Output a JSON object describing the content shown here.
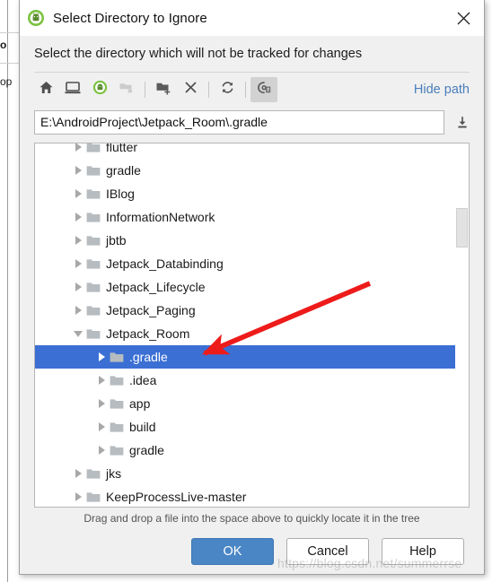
{
  "window": {
    "title": "Select Directory to Ignore",
    "app_icon": "android-studio-icon",
    "close_icon": "close-icon",
    "subtitle": "Select the directory which will not be tracked for changes"
  },
  "toolbar": {
    "items": [
      {
        "icon": "home-icon",
        "name": "home-button",
        "state": "enabled"
      },
      {
        "icon": "desktop-icon",
        "name": "desktop-button",
        "state": "enabled"
      },
      {
        "icon": "project-icon",
        "name": "project-directory-button",
        "state": "enabled"
      },
      {
        "icon": "folder-up-icon",
        "name": "parent-directory-button",
        "state": "disabled"
      },
      {
        "icon": "new-folder-icon",
        "name": "new-folder-button",
        "state": "enabled"
      },
      {
        "icon": "delete-icon",
        "name": "delete-button",
        "state": "enabled"
      },
      {
        "icon": "refresh-icon",
        "name": "refresh-button",
        "state": "enabled"
      },
      {
        "icon": "show-hidden-icon",
        "name": "show-hidden-files-button",
        "state": "pressed"
      }
    ],
    "hide_path_label": "Hide path"
  },
  "path": {
    "value": "E:\\AndroidProject\\Jetpack_Room\\.gradle",
    "placeholder": "",
    "download_icon": "locate-file-icon"
  },
  "tree": {
    "rows": [
      {
        "label": "flutter",
        "indent": 1,
        "twisty": "collapsed",
        "selected": false,
        "clipped": true
      },
      {
        "label": "gradle",
        "indent": 1,
        "twisty": "collapsed",
        "selected": false
      },
      {
        "label": "IBlog",
        "indent": 1,
        "twisty": "collapsed",
        "selected": false
      },
      {
        "label": "InformationNetwork",
        "indent": 1,
        "twisty": "collapsed",
        "selected": false
      },
      {
        "label": "jbtb",
        "indent": 1,
        "twisty": "collapsed",
        "selected": false
      },
      {
        "label": "Jetpack_Databinding",
        "indent": 1,
        "twisty": "collapsed",
        "selected": false
      },
      {
        "label": "Jetpack_Lifecycle",
        "indent": 1,
        "twisty": "collapsed",
        "selected": false
      },
      {
        "label": "Jetpack_Paging",
        "indent": 1,
        "twisty": "collapsed",
        "selected": false
      },
      {
        "label": "Jetpack_Room",
        "indent": 1,
        "twisty": "expanded",
        "selected": false
      },
      {
        "label": ".gradle",
        "indent": 2,
        "twisty": "collapsed",
        "selected": true
      },
      {
        "label": ".idea",
        "indent": 2,
        "twisty": "collapsed",
        "selected": false
      },
      {
        "label": "app",
        "indent": 2,
        "twisty": "collapsed",
        "selected": false
      },
      {
        "label": "build",
        "indent": 2,
        "twisty": "collapsed",
        "selected": false
      },
      {
        "label": "gradle",
        "indent": 2,
        "twisty": "collapsed",
        "selected": false
      },
      {
        "label": "jks",
        "indent": 1,
        "twisty": "collapsed",
        "selected": false
      },
      {
        "label": "KeepProcessLive-master",
        "indent": 1,
        "twisty": "collapsed",
        "selected": false
      }
    ],
    "selection_color": "#3b6fd4",
    "folder_icon": "folder-icon"
  },
  "hint": "Drag and drop a file into the space above to quickly locate it in the tree",
  "buttons": {
    "ok": "OK",
    "cancel": "Cancel",
    "help": "Help",
    "ok_color": "#4a86c5"
  },
  "annotation": {
    "arrow": "red-arrow-annotation",
    "arrow_color": "#ee1b1b"
  },
  "watermark": "https://blog.csdn.net/summerrse",
  "backdrop": {
    "fragment_1": "o",
    "fragment_2": "op"
  }
}
